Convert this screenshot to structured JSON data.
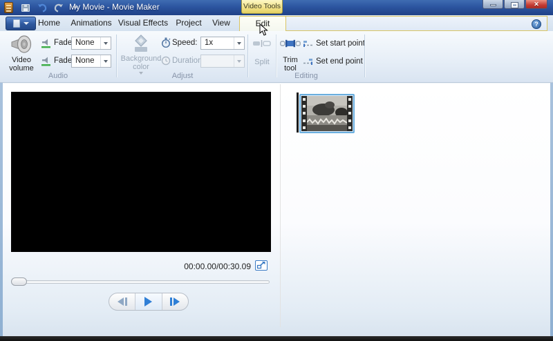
{
  "titlebar": {
    "title": "My Movie - Movie Maker",
    "contextual_group_label": "Video Tools"
  },
  "ribbon": {
    "tabs": [
      {
        "label": "Home",
        "active": false
      },
      {
        "label": "Animations",
        "active": false
      },
      {
        "label": "Visual Effects",
        "active": false
      },
      {
        "label": "Project",
        "active": false
      },
      {
        "label": "View",
        "active": false
      },
      {
        "label": "Edit",
        "active": true
      }
    ],
    "groups": {
      "audio": {
        "label": "Audio",
        "video_volume_label": "Video volume",
        "fade_in_label": "Fade in:",
        "fade_in_value": "None",
        "fade_out_label": "Fade out:",
        "fade_out_value": "None"
      },
      "adjust": {
        "label": "Adjust",
        "background_color_label": "Background color",
        "background_color_enabled": false,
        "speed_label": "Speed:",
        "speed_value": "1x",
        "duration_label": "Duration:",
        "duration_value": "",
        "duration_enabled": false
      },
      "editing": {
        "label": "Editing",
        "split_label": "Split",
        "split_enabled": false,
        "trim_tool_label": "Trim tool",
        "set_start_label": "Set start point",
        "set_end_label": "Set end point"
      }
    },
    "help_glyph": "?"
  },
  "preview": {
    "time_display": "00:00.00/00:30.09",
    "slider_position": 0
  },
  "storyboard": {
    "clip_count": 1,
    "selected_clip": 1
  },
  "window_controls": {
    "close_glyph": "✕"
  },
  "colors": {
    "titlebar_blue": "#2c55a0",
    "contextual_yellow": "#eedd7d",
    "selection_blue": "#6aaede",
    "accent_blue": "#2f7fd6"
  }
}
